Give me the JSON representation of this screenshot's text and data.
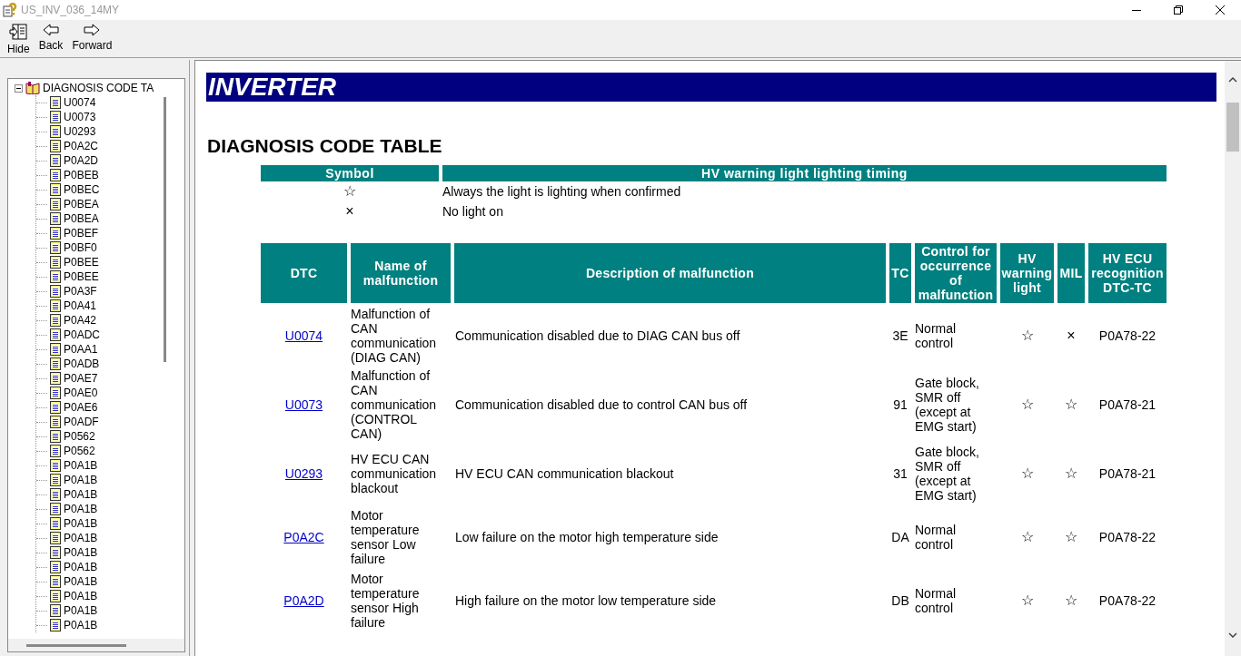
{
  "window": {
    "title": "US_INV_036_14MY"
  },
  "toolbar": [
    {
      "kind": "hide",
      "label": "Hide"
    },
    {
      "kind": "back",
      "label": "Back"
    },
    {
      "kind": "forward",
      "label": "Forward"
    }
  ],
  "tree": {
    "label": "DIAGNOSIS CODE TA",
    "expanded": true,
    "children": [
      {
        "label": "U0074"
      },
      {
        "label": "U0073"
      },
      {
        "label": "U0293"
      },
      {
        "label": "P0A2C"
      },
      {
        "label": "P0A2D"
      },
      {
        "label": "P0BEB"
      },
      {
        "label": "P0BEC"
      },
      {
        "label": "P0BEA"
      },
      {
        "label": "P0BEA"
      },
      {
        "label": "P0BEF"
      },
      {
        "label": "P0BF0"
      },
      {
        "label": "P0BEE"
      },
      {
        "label": "P0BEE"
      },
      {
        "label": "P0A3F"
      },
      {
        "label": "P0A41"
      },
      {
        "label": "P0A42"
      },
      {
        "label": "P0ADC"
      },
      {
        "label": "P0AA1"
      },
      {
        "label": "P0ADB"
      },
      {
        "label": "P0AE7"
      },
      {
        "label": "P0AE0"
      },
      {
        "label": "P0AE6"
      },
      {
        "label": "P0ADF"
      },
      {
        "label": "P0562"
      },
      {
        "label": "P0562"
      },
      {
        "label": "P0A1B"
      },
      {
        "label": "P0A1B"
      },
      {
        "label": "P0A1B"
      },
      {
        "label": "P0A1B"
      },
      {
        "label": "P0A1B"
      },
      {
        "label": "P0A1B"
      },
      {
        "label": "P0A1B"
      },
      {
        "label": "P0A1B"
      },
      {
        "label": "P0A1B"
      },
      {
        "label": "P0A1B"
      },
      {
        "label": "P0A1B"
      },
      {
        "label": "P0A1B"
      }
    ]
  },
  "content": {
    "banner": "INVERTER",
    "heading": "DIAGNOSIS CODE TABLE",
    "legend": {
      "columns": [
        "Symbol",
        "HV warning light lighting timing"
      ],
      "rows": [
        {
          "symbol": "☆",
          "meaning": "Always the light is lighting when confirmed"
        },
        {
          "symbol": "×",
          "meaning": "No light on"
        }
      ]
    },
    "table": {
      "columns": [
        "DTC",
        "Name of malfunction",
        "Description of malfunction",
        "TC",
        "Control for occurrence of malfunction",
        "HV warning light",
        "MIL",
        "HV ECU recognition DTC-TC"
      ],
      "rows": [
        {
          "dtc": "U0074",
          "name": "Malfunction of CAN communication (DIAG CAN)",
          "description": "Communication disabled due to DIAG CAN bus off",
          "tc": "3E",
          "control": "Normal control",
          "hv_light": "☆",
          "mil": "×",
          "hv_ecu": "P0A78-22"
        },
        {
          "dtc": "U0073",
          "name": "Malfunction of CAN communication (CONTROL CAN)",
          "description": "Communication disabled due to control CAN bus off",
          "tc": "91",
          "control": "Gate block, SMR off (except at EMG start)",
          "hv_light": "☆",
          "mil": "☆",
          "hv_ecu": "P0A78-21"
        },
        {
          "dtc": "U0293",
          "name": "HV ECU CAN communication blackout",
          "description": "HV ECU CAN communication blackout",
          "tc": "31",
          "control": "Gate block, SMR off (except at EMG start)",
          "hv_light": "☆",
          "mil": "☆",
          "hv_ecu": "P0A78-21"
        },
        {
          "dtc": "P0A2C",
          "name": "Motor temperature sensor Low failure",
          "description": "Low failure on the motor high temperature side",
          "tc": "DA",
          "control": "Normal control",
          "hv_light": "☆",
          "mil": "☆",
          "hv_ecu": "P0A78-22"
        },
        {
          "dtc": "P0A2D",
          "name": "Motor temperature sensor High failure",
          "description": "High failure on the motor low temperature side",
          "tc": "DB",
          "control": "Normal control",
          "hv_light": "☆",
          "mil": "☆",
          "hv_ecu": "P0A78-22"
        }
      ]
    }
  }
}
